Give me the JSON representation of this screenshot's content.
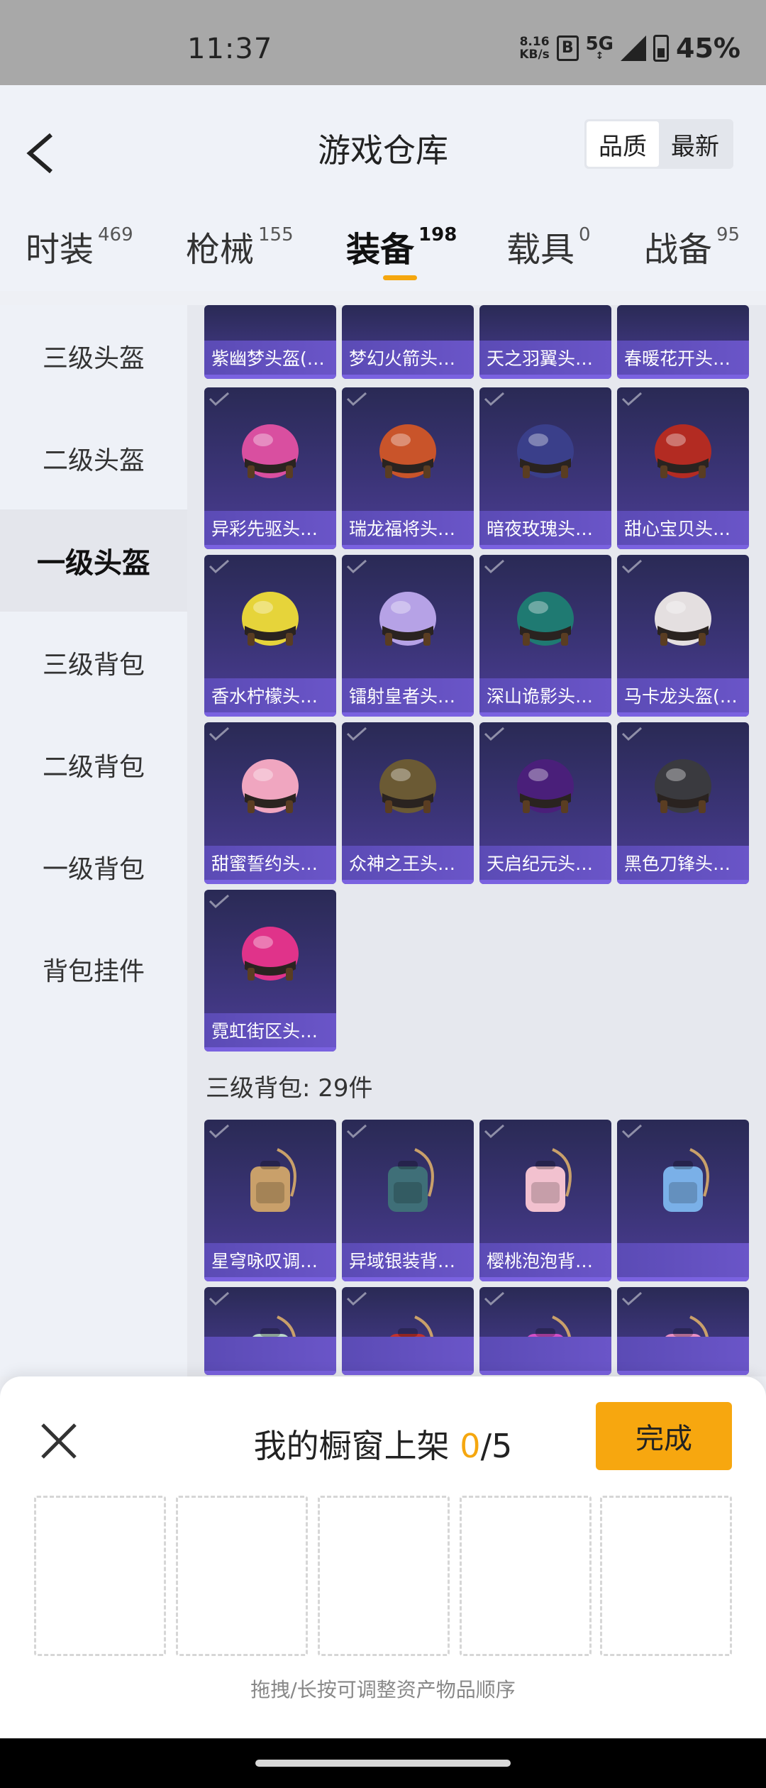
{
  "status_bar": {
    "time": "11:37",
    "net_speed_value": "8.16",
    "net_speed_unit": "KB/s",
    "bluetooth_glyph": "B",
    "network": "5G",
    "battery": "45%"
  },
  "header": {
    "title": "游戏仓库",
    "sort_options": [
      "品质",
      "最新"
    ],
    "sort_active": "品质"
  },
  "tabs": [
    {
      "label": "时装",
      "count": "469"
    },
    {
      "label": "枪械",
      "count": "155"
    },
    {
      "label": "装备",
      "count": "198"
    },
    {
      "label": "载具",
      "count": "0"
    },
    {
      "label": "战备",
      "count": "95"
    }
  ],
  "active_tab": "装备",
  "sidebar": {
    "items": [
      "三级头盔",
      "二级头盔",
      "一级头盔",
      "三级背包",
      "二级背包",
      "一级背包",
      "背包挂件"
    ],
    "active": "一级头盔"
  },
  "items_top_row": [
    "紫幽梦头盔(1...",
    "梦幻火箭头盔...",
    "天之羽翼头盔...",
    "春暖花开头盔..."
  ],
  "items_helmets": [
    {
      "name": "异彩先驱头盔...",
      "icon": "helmet-icon",
      "color": "#d94fa0"
    },
    {
      "name": "瑞龙福将头盔...",
      "icon": "helmet-icon",
      "color": "#c9542a"
    },
    {
      "name": "暗夜玫瑰头盔...",
      "icon": "helmet-icon",
      "color": "#3a3f8a"
    },
    {
      "name": "甜心宝贝头盔...",
      "icon": "helmet-icon",
      "color": "#b32b22"
    },
    {
      "name": "香水柠檬头盔...",
      "icon": "helmet-icon",
      "color": "#e6d43a"
    },
    {
      "name": "镭射皇者头盔...",
      "icon": "helmet-icon",
      "color": "#b6a2e6"
    },
    {
      "name": "深山诡影头盔...",
      "icon": "helmet-icon",
      "color": "#1f7a72"
    },
    {
      "name": "马卡龙头盔(1...",
      "icon": "helmet-icon",
      "color": "#e4dfe0"
    },
    {
      "name": "甜蜜誓约头盔...",
      "icon": "helmet-icon",
      "color": "#f0a6c0"
    },
    {
      "name": "众神之王头盔...",
      "icon": "helmet-icon",
      "color": "#6b5a34"
    },
    {
      "name": "天启纪元头盔...",
      "icon": "helmet-icon",
      "color": "#4a1f7a"
    },
    {
      "name": "黑色刀锋头盔...",
      "icon": "helmet-icon",
      "color": "#3a3a3f"
    },
    {
      "name": "霓虹街区头盔...",
      "icon": "helmet-icon",
      "color": "#e0338a"
    }
  ],
  "backpack_section": {
    "title": "三级背包: 29件",
    "items": [
      {
        "name": "星穹咏叹调背...",
        "icon": "backpack-icon",
        "color": "#c9a06a"
      },
      {
        "name": "异域银装背包...",
        "icon": "backpack-icon",
        "color": "#3f6f78"
      },
      {
        "name": "樱桃泡泡背包...",
        "icon": "backpack-icon",
        "color": "#f2c1cf"
      },
      {
        "name": "",
        "icon": "backpack-icon",
        "color": "#7ab0e8"
      },
      {
        "name": "",
        "icon": "backpack-icon",
        "color": "#b9d7c9"
      },
      {
        "name": "",
        "icon": "backpack-icon",
        "color": "#c2322e"
      },
      {
        "name": "",
        "icon": "backpack-icon",
        "color": "#d24fc6"
      },
      {
        "name": "",
        "icon": "backpack-icon",
        "color": "#e98fc2"
      }
    ]
  },
  "sheet": {
    "title_prefix": "我的橱窗上架 ",
    "count_current": "0",
    "count_total": "/5",
    "done_label": "完成",
    "hint": "拖拽/长按可调整资产物品顺序"
  },
  "colors": {
    "accent": "#f7a70f",
    "card_name_bar": "#6a55c8"
  }
}
